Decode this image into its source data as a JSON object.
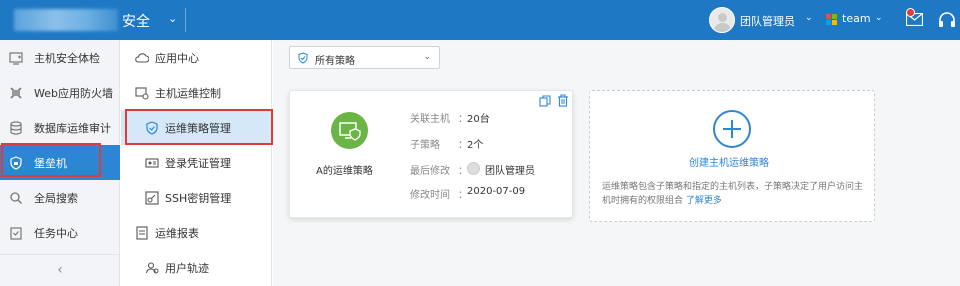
{
  "header": {
    "brand_suffix": "安全",
    "user_name": "团队管理员",
    "team_name": "team"
  },
  "sidebar": {
    "items": [
      {
        "label": "主机安全体检",
        "icon": "host-check-icon"
      },
      {
        "label": "Web应用防火墙",
        "icon": "waf-icon"
      },
      {
        "label": "数据库运维审计",
        "icon": "database-icon"
      },
      {
        "label": "堡垒机",
        "icon": "bastion-icon",
        "active": true
      },
      {
        "label": "全局搜索",
        "icon": "search-icon"
      },
      {
        "label": "任务中心",
        "icon": "task-icon"
      }
    ],
    "collapse_label": "‹"
  },
  "subnav": {
    "items": [
      {
        "label": "应用中心",
        "icon": "app-center-icon",
        "level": 1
      },
      {
        "label": "主机运维控制",
        "icon": "host-ops-icon",
        "level": 1
      },
      {
        "label": "运维策略管理",
        "icon": "shield-icon",
        "level": 2,
        "active": true
      },
      {
        "label": "登录凭证管理",
        "icon": "credential-icon",
        "level": 2
      },
      {
        "label": "SSH密钥管理",
        "icon": "key-icon",
        "level": 2
      },
      {
        "label": "运维报表",
        "icon": "report-icon",
        "level": 1
      },
      {
        "label": "用户轨迹",
        "icon": "user-trace-icon",
        "level": 2
      }
    ]
  },
  "filter": {
    "selected": "所有策略"
  },
  "policy_card": {
    "name": "A的运维策略",
    "fields": [
      {
        "key": "关联主机",
        "value": "20台"
      },
      {
        "key": "子策略",
        "value": "2个"
      },
      {
        "key": "最后修改",
        "value": "团队管理员"
      },
      {
        "key": "修改时间",
        "value": "2020-07-09"
      }
    ]
  },
  "create_card": {
    "label": "创建主机运维策略",
    "description": "运维策略包含子策略和指定的主机列表，子策略决定了用户访问主机时拥有的权限组合",
    "link": "了解更多"
  },
  "colors": {
    "header_bg": "#1f78c4",
    "active_blue": "#2d86d3",
    "policy_green": "#6ab545",
    "highlight_red": "#e03a3a"
  }
}
